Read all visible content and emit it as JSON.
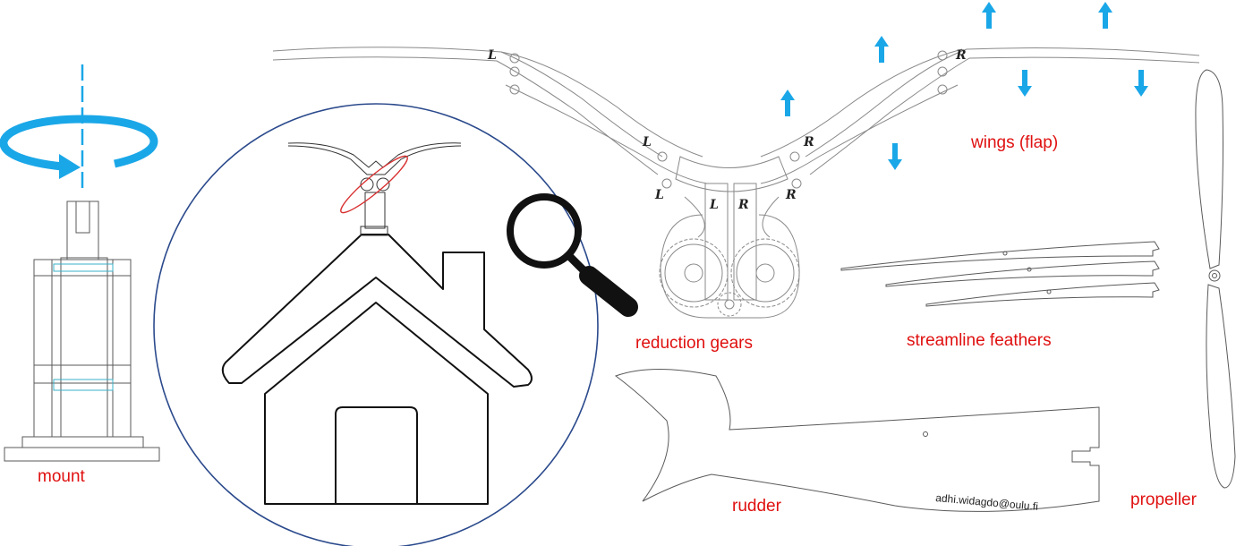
{
  "colors": {
    "label": "#e01010",
    "arrow": "#1aa7e8",
    "outline": "#5a5a5a",
    "circle": "#2b4a8c",
    "house": "#111111",
    "accent_red": "#d83030",
    "accent_teal": "#3ab0c8"
  },
  "labels": {
    "wings": "wings (flap)",
    "reduction_gears": "reduction gears",
    "streamline_feathers": "streamline feathers",
    "rudder": "rudder",
    "propeller": "propeller",
    "mount": "mount",
    "email": "adhi.widagdo@oulu.fi"
  },
  "wing_marks": {
    "left": "L",
    "right": "R"
  },
  "icons": [
    "rotation-arrow-icon",
    "magnifier-icon",
    "house-icon",
    "arrow-up-icon",
    "arrow-down-icon"
  ],
  "flap_arrows": {
    "up_count": 4,
    "down_count": 3
  }
}
